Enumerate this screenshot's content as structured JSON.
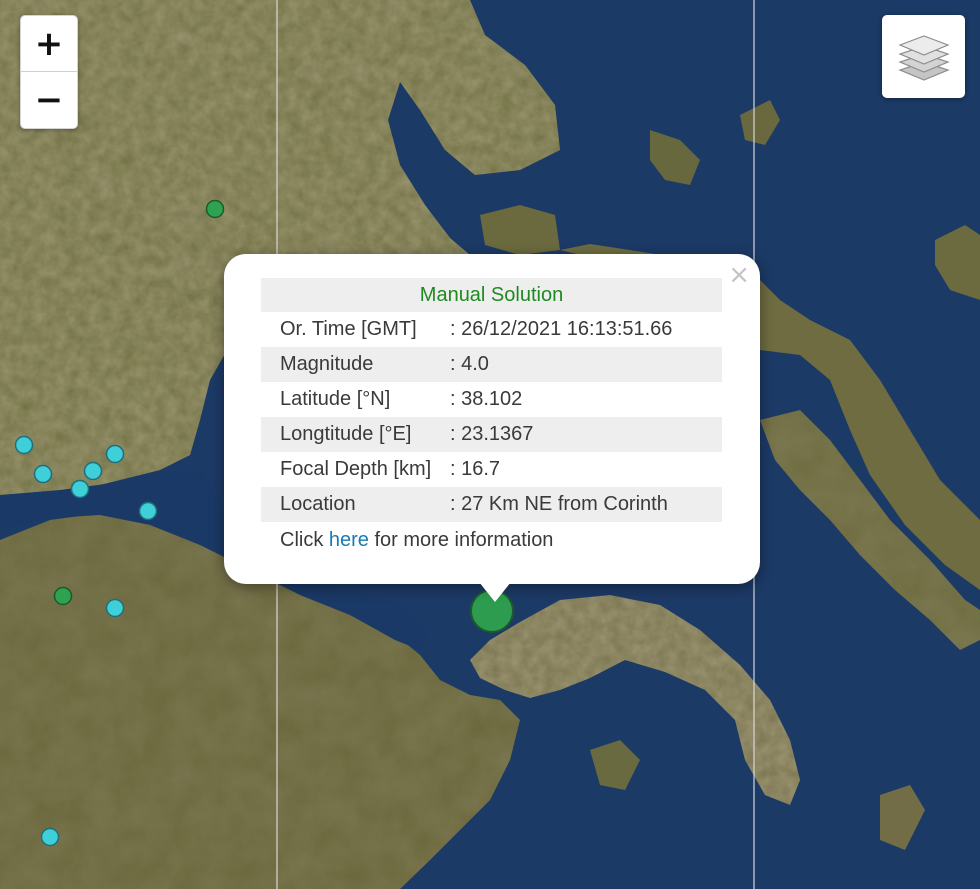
{
  "zoom": {
    "in_label": "+",
    "out_label": "−"
  },
  "layers": {
    "icon": "layers-icon"
  },
  "popup": {
    "close_label": "×",
    "title": "Manual Solution",
    "rows": [
      {
        "label": "Or. Time [GMT]",
        "value": ": 26/12/2021 16:13:51.66"
      },
      {
        "label": "Magnitude",
        "value": ": 4.0"
      },
      {
        "label": "Latitude [°N]",
        "value": ": 38.102"
      },
      {
        "label": "Longtitude [°E]",
        "value": ": 23.1367"
      },
      {
        "label": "Focal Depth [km]",
        "value": ": 16.7"
      },
      {
        "label": "Location",
        "value": ": 27 Km NE from Corinth"
      }
    ],
    "more_prefix": "Click ",
    "more_link": "here",
    "more_suffix": " for more information"
  },
  "colors": {
    "sea": "#1c3a66",
    "land": "#6b6a3c",
    "event_selected": "#2e9c4e",
    "event_green": "#2fa24f",
    "event_cyan": "#3fcfd8",
    "title_green": "#1f8a1f",
    "link_blue": "#1a7ab8"
  },
  "markers": {
    "selected": {
      "name": "selected-event-marker",
      "color": "#2e9c4e"
    },
    "green": {
      "name": "earthquake-marker-green",
      "color": "#2fa24f",
      "count": 2
    },
    "cyan": {
      "name": "earthquake-marker-cyan",
      "color": "#3fcfd8",
      "count": 9
    }
  }
}
